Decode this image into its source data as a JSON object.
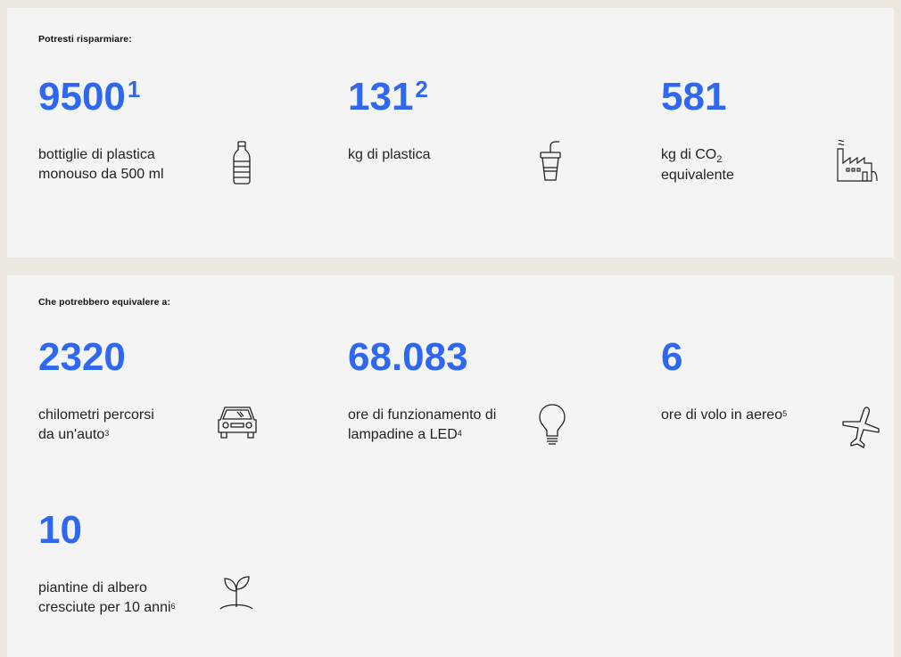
{
  "savings": {
    "label": "Potresti risparmiare:",
    "items": [
      {
        "value": "9500",
        "value_note": "1",
        "text_main": "bottiglie di plastica monouso da 500 ml",
        "icon": "bottle-icon"
      },
      {
        "value": "131",
        "value_note": "2",
        "text_main": "kg di plastica",
        "icon": "plastic-cup-icon"
      },
      {
        "value": "581",
        "text_prefix": "kg di CO",
        "text_sub": "2",
        "text_suffix": " equivalente",
        "icon": "factory-icon"
      }
    ]
  },
  "equivalents": {
    "label": "Che potrebbero equivalere a:",
    "items": [
      {
        "value": "2320",
        "text_main": "chilometri percorsi da un'auto",
        "text_note": "3",
        "icon": "car-icon"
      },
      {
        "value": "68.083",
        "text_main": "ore di funzionamento di lampadine a LED",
        "text_note": "4",
        "icon": "lightbulb-icon"
      },
      {
        "value": "6",
        "text_main": "ore di volo in aereo",
        "text_note": "5",
        "icon": "airplane-icon"
      },
      {
        "value": "10",
        "text_main": "piantine di albero cresciute per 10 anni",
        "text_note": "6",
        "icon": "sprout-icon"
      }
    ]
  },
  "colors": {
    "accent": "#2e67f0",
    "panel": "#f4f4f4",
    "background": "#ece8e0"
  }
}
